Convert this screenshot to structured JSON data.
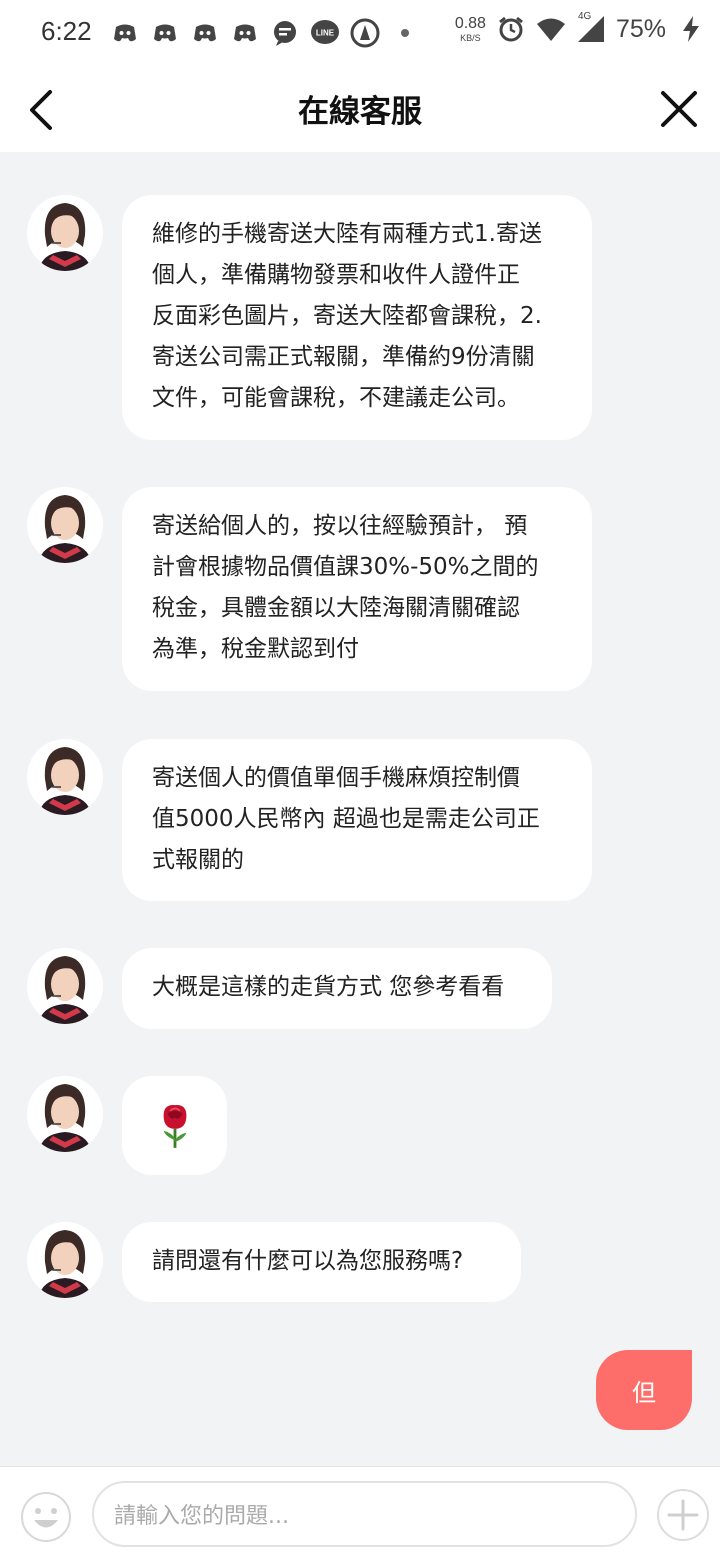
{
  "status_bar": {
    "time": "6:22",
    "net_speed_value": "0.88",
    "net_speed_unit": "KB/S",
    "network_label": "4G",
    "battery": "75%",
    "icons": [
      "discord-icon",
      "discord-icon",
      "discord-icon",
      "discord-icon",
      "chat-icon",
      "line-icon",
      "app-icon",
      "dot-icon",
      "alarm-icon",
      "wifi-icon",
      "signal-icon",
      "charging-icon"
    ]
  },
  "header": {
    "title": "在線客服",
    "back_icon": "chevron-left-icon",
    "close_icon": "close-icon"
  },
  "messages": [
    {
      "from": "agent",
      "text": "維修的手機寄送大陸有兩種方式1.寄送\n個人，準備購物發票和收件人證件正\n反面彩色圖片，寄送大陸都會課稅，2.\n寄送公司需正式報關，準備約9份清關\n文件，可能會課稅，不建議走公司。"
    },
    {
      "from": "agent",
      "text": "寄送給個人的，按以往經驗預計， 預\n計會根據物品價值課30%-50%之間的\n稅金，具體金額以大陸海關清關確認\n為準，稅金默認到付"
    },
    {
      "from": "agent",
      "text": "寄送個人的價值單個手機麻煩控制價\n值5000人民幣內 超過也是需走公司正\n式報關的"
    },
    {
      "from": "agent",
      "text": "大概是這樣的走貨方式 您參考看看"
    },
    {
      "from": "agent",
      "text": "🌹",
      "emoji": "rose-emoji"
    },
    {
      "from": "agent",
      "text": "請問還有什麼可以為您服務嗎?"
    },
    {
      "from": "user",
      "text": "但"
    }
  ],
  "input_bar": {
    "placeholder": "請輸入您的問題...",
    "emoji_icon": "smiley-icon",
    "plus_icon": "plus-icon"
  },
  "colors": {
    "background": "#f2f3f5",
    "bubble_agent": "#ffffff",
    "bubble_user": "#fd6d6a",
    "header_bg": "#ffffff"
  }
}
